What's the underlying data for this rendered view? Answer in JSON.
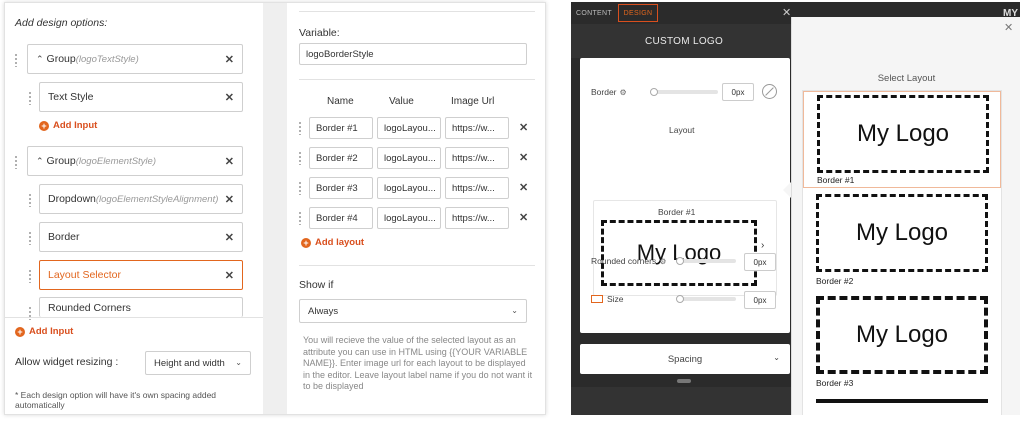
{
  "left": {
    "add_design_label": "Add design options:",
    "options": [
      {
        "name": "Group",
        "sub": "(logoTextStyle)"
      },
      {
        "name": "Text Style",
        "sub": ""
      },
      {
        "name": "Group",
        "sub": "(logoElementStyle)"
      },
      {
        "name": "Dropdown",
        "sub": "(logoElementStyleAlignment)"
      },
      {
        "name": "Border",
        "sub": ""
      },
      {
        "name": "Layout Selector",
        "sub": ""
      },
      {
        "name": "Rounded Corners",
        "sub": ""
      }
    ],
    "add_input_label": "Add Input",
    "add_input_bottom_label": "Add Input",
    "resize_label": "Allow widget resizing :",
    "resize_value": "Height and width",
    "footnote": "* Each design option will have it's own spacing added automatically"
  },
  "middle": {
    "variable_label": "Variable:",
    "variable_value": "logoBorderStyle",
    "col_name": "Name",
    "col_value": "Value",
    "col_image": "Image Url",
    "rows": [
      {
        "name": "Border #1",
        "value": "logoLayou...",
        "url": "https://w..."
      },
      {
        "name": "Border #2",
        "value": "logoLayou...",
        "url": "https://w..."
      },
      {
        "name": "Border #3",
        "value": "logoLayou...",
        "url": "https://w..."
      },
      {
        "name": "Border #4",
        "value": "logoLayou...",
        "url": "https://w..."
      }
    ],
    "add_layout_label": "Add layout",
    "show_if_label": "Show if",
    "show_if_value": "Always",
    "help_text": "You will recieve the value of the selected layout as an attribute you can use in HTML using {{YOUR VARIABLE NAME}}. Enter image url for each layout to be displayed in the editor. Leave layout label name if you do not want it to be displayed"
  },
  "preview": {
    "tab_content": "CONTENT",
    "tab_design": "DESIGN",
    "title": "CUSTOM LOGO",
    "border_label": "Border",
    "border_value": "0px",
    "layout_label": "Layout",
    "layout_caption": "Border #1",
    "logo_text": "My Logo",
    "rounded_label": "Rounded corners",
    "rounded_value": "0px",
    "size_label": "Size",
    "size_value": "0px",
    "spacing_label": "Spacing",
    "corner_text": "MY",
    "popup_title": "Select Layout",
    "layouts": [
      {
        "caption": "Border #1",
        "logo": "My Logo"
      },
      {
        "caption": "Border #2",
        "logo": "My Logo"
      },
      {
        "caption": "Border #3",
        "logo": "My Logo"
      }
    ]
  },
  "colors": {
    "accent": "#e2661e",
    "dark_panel": "#2b2b2b"
  }
}
